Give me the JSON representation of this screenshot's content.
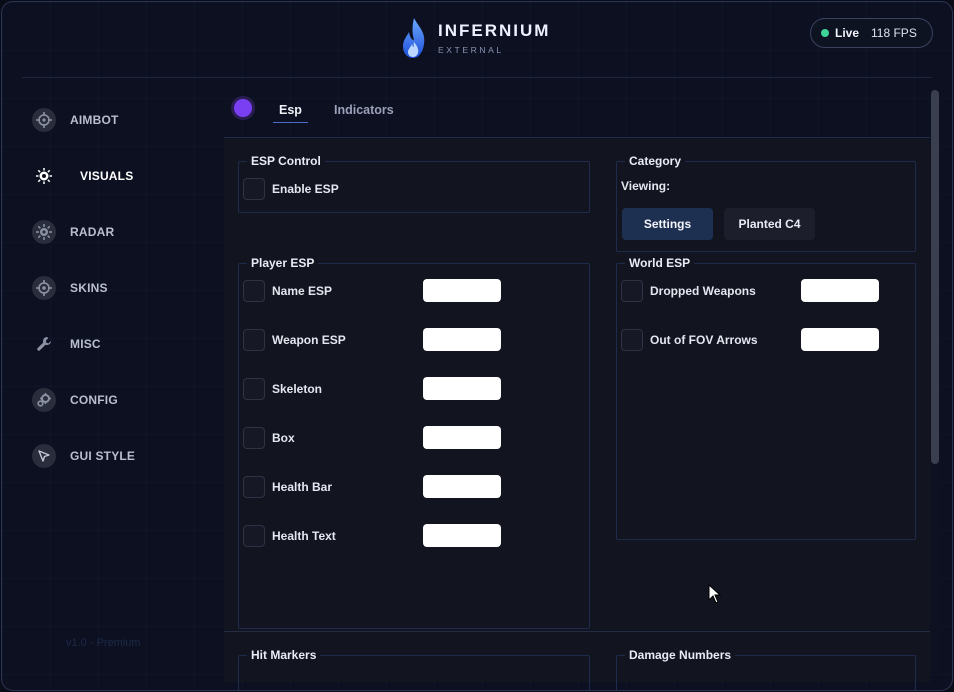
{
  "header": {
    "brand_title": "INFERNIUM",
    "brand_subtitle": "EXTERNAL",
    "status_live": "Live",
    "status_fps": "118 FPS",
    "live_color": "#3ed598"
  },
  "sidebar": {
    "items": [
      {
        "label": "AIMBOT",
        "icon": "crosshair-icon"
      },
      {
        "label": "VISUALS",
        "icon": "sun-eye-icon",
        "active": true
      },
      {
        "label": "RADAR",
        "icon": "radar-icon"
      },
      {
        "label": "SKINS",
        "icon": "target-icon"
      },
      {
        "label": "MISC",
        "icon": "wrench-icon"
      },
      {
        "label": "CONFIG",
        "icon": "gears-icon"
      },
      {
        "label": "GUI STYLE",
        "icon": "compass-icon"
      }
    ],
    "version": "v1.0 - Premium"
  },
  "tabs": {
    "items": [
      "Esp",
      "Indicators"
    ],
    "active": "Esp",
    "accent": "#7a3ff2"
  },
  "esp_control": {
    "title": "ESP Control",
    "enable_label": "Enable ESP"
  },
  "category": {
    "title": "Category",
    "viewing_label": "Viewing:",
    "buttons": [
      "Settings",
      "Planted C4"
    ]
  },
  "player_esp": {
    "title": "Player ESP",
    "rows": [
      "Name ESP",
      "Weapon ESP",
      "Skeleton",
      "Box",
      "Health Bar",
      "Health Text"
    ]
  },
  "world_esp": {
    "title": "World ESP",
    "rows": [
      "Dropped Weapons",
      "Out of FOV Arrows"
    ]
  },
  "lower_groups": {
    "hit_markers": "Hit Markers",
    "damage_numbers": "Damage Numbers"
  }
}
